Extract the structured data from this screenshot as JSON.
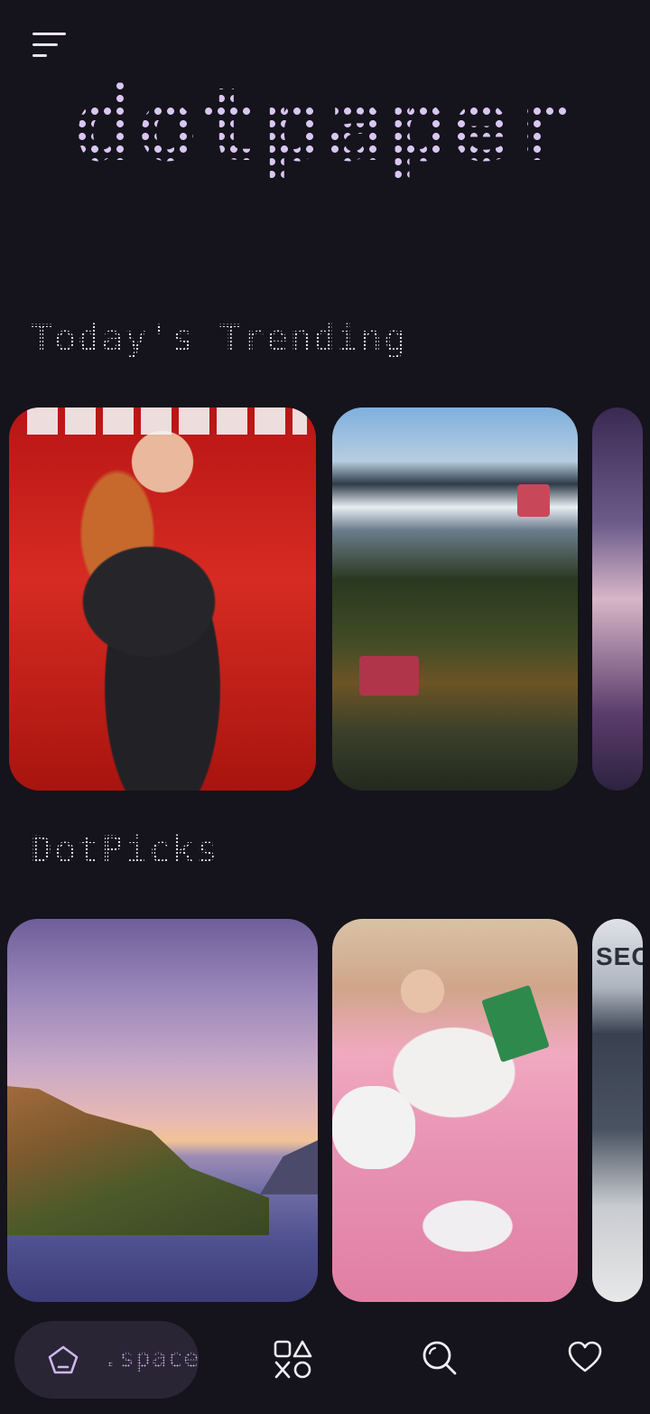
{
  "app": {
    "brand": "dotpaper"
  },
  "sections": {
    "trending_title": "Today's Trending",
    "picks_title": "DotPicks"
  },
  "cover_overlay": {
    "p3_text": "SEC"
  },
  "nav": {
    "space_label": ".space",
    "items": [
      {
        "icon": "home-pentagon-icon",
        "label": ".space"
      },
      {
        "icon": "shapes-icon"
      },
      {
        "icon": "search-icon"
      },
      {
        "icon": "heart-icon"
      }
    ]
  },
  "colors": {
    "background": "#15131b",
    "accent": "#cdb7f0",
    "nav_active_bg": "#2a2534"
  }
}
